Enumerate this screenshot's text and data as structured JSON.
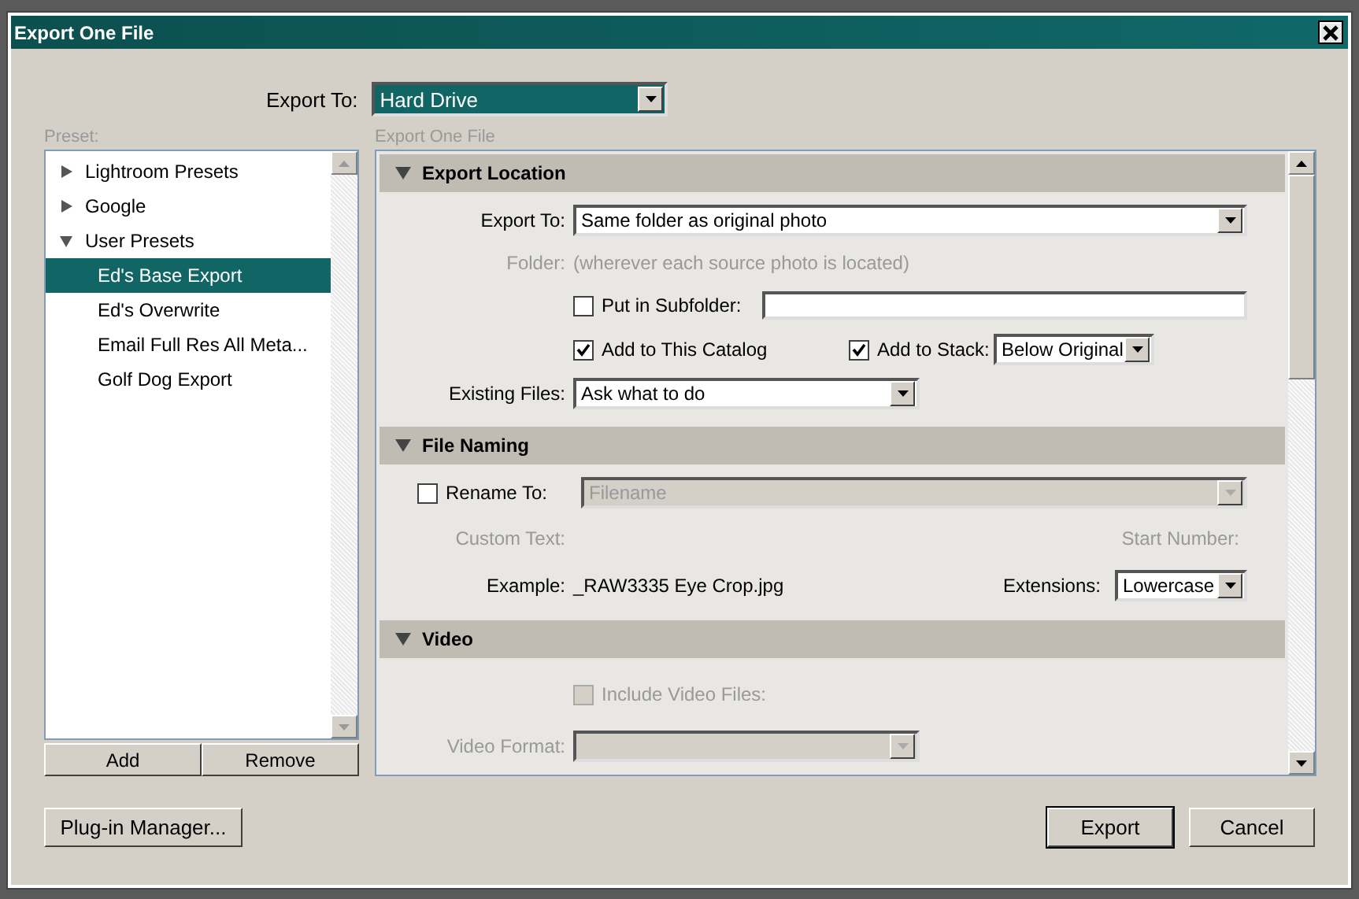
{
  "window": {
    "title": "Export One File"
  },
  "export_to": {
    "label": "Export To:",
    "value": "Hard Drive"
  },
  "preset": {
    "label": "Preset:",
    "items": [
      {
        "label": "Lightroom Presets",
        "expanded": false,
        "selected": false
      },
      {
        "label": "Google",
        "expanded": false,
        "selected": false
      },
      {
        "label": "User Presets",
        "expanded": true,
        "selected": false,
        "children": [
          {
            "label": "Ed's Base Export",
            "selected": true
          },
          {
            "label": "Ed's Overwrite",
            "selected": false
          },
          {
            "label": "Email Full Res All Meta...",
            "selected": false
          },
          {
            "label": "Golf Dog Export",
            "selected": false
          }
        ]
      }
    ],
    "buttons": [
      "Add",
      "Remove"
    ]
  },
  "panel": {
    "title": "Export One File",
    "sections": [
      {
        "title": "Export Location",
        "expanded": true,
        "rows": [
          {
            "kind": "select",
            "label": "Export To:",
            "value": "Same folder as original photo",
            "disabled": false
          },
          {
            "kind": "note",
            "label": "Folder:",
            "text": "(wherever each source photo is located)"
          },
          {
            "kind": "check_field",
            "label": "Put in Subfolder:",
            "checked": false
          },
          {
            "kind": "check_pair",
            "label": "Add to This Catalog",
            "checked": true,
            "label2": "Add to Stack:",
            "checked2": true,
            "value": "Below Original"
          },
          {
            "kind": "select_short",
            "label": "Existing Files:",
            "value": "Ask what to do",
            "disabled": false
          }
        ]
      },
      {
        "title": "File Naming",
        "expanded": true,
        "rows": [
          {
            "kind": "check_select",
            "label": "Rename To:",
            "checked": false,
            "value": "Filename",
            "disabled": true
          },
          {
            "kind": "label_pair",
            "label": "Custom Text:",
            "label2": "Start Number:"
          },
          {
            "kind": "example",
            "label": "Example:",
            "text": "_RAW3335 Eye Crop.jpg",
            "label2": "Extensions:",
            "value": "Lowercase"
          }
        ]
      },
      {
        "title": "Video",
        "expanded": true,
        "rows": [
          {
            "kind": "check",
            "label": "Include Video Files:",
            "checked": false,
            "disabled": true
          },
          {
            "kind": "select_short",
            "label": "Video Format:",
            "disabled": true
          }
        ]
      }
    ]
  },
  "footer": {
    "left": "Plug-in Manager...",
    "primary": "Export",
    "cancel": "Cancel"
  }
}
